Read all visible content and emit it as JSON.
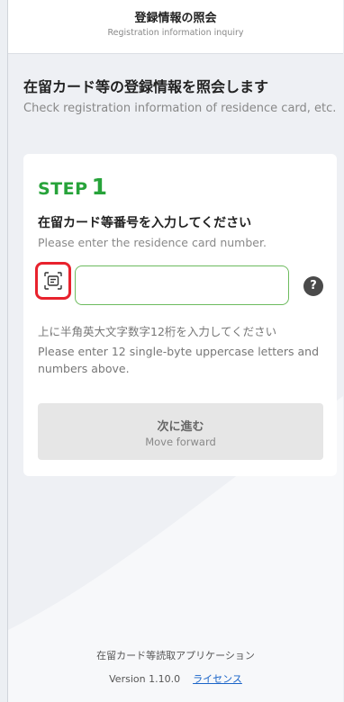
{
  "header": {
    "title": "登録情報の照会",
    "subtitle": "Registration information inquiry"
  },
  "page": {
    "title": "在留カード等の登録情報を照会します",
    "subtitle": "Check registration information of residence card, etc."
  },
  "step": {
    "word": "STEP",
    "number": "1",
    "instruction": "在留カード等番号を入力してください",
    "instruction_en": "Please enter the residence card number.",
    "input_value": "",
    "input_placeholder": "",
    "help_label": "?",
    "hint": "上に半角英大文字数字12桁を入力してください",
    "hint_en": "Please enter 12 single-byte uppercase letters and numbers above."
  },
  "next_button": {
    "label": "次に進む",
    "label_en": "Move forward"
  },
  "footer": {
    "app_name": "在留カード等読取アプリケーション",
    "version": "Version 1.10.0",
    "license_link": "ライセンス"
  },
  "icons": {
    "scan": "card-scan-icon",
    "help": "question-mark-icon"
  },
  "colors": {
    "accent_green": "#27a33a",
    "input_border": "#6dbb5e",
    "highlight_red": "#e8222d",
    "link_blue": "#1a64c8",
    "disabled_button": "#e6e6e6"
  }
}
